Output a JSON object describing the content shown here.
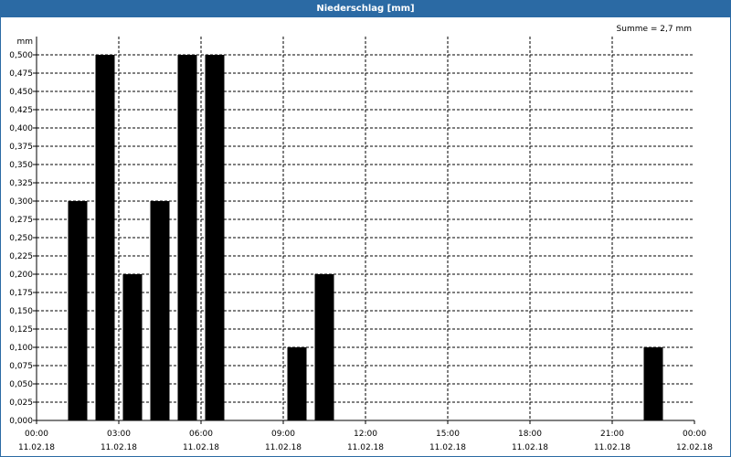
{
  "window": {
    "title": "Niederschlag [mm]"
  },
  "summary": {
    "text": "Summe = 2,7 mm"
  },
  "colors": {
    "titlebar": "#2b6aa4",
    "bar": "#000000",
    "grid": "#000000",
    "background": "#ffffff"
  },
  "chart_data": {
    "type": "bar",
    "title": "Niederschlag [mm]",
    "ylabel": "mm",
    "ylim": [
      0,
      0.5
    ],
    "yticks": [
      "0,000",
      "0,025",
      "0,050",
      "0,075",
      "0,100",
      "0,125",
      "0,150",
      "0,175",
      "0,200",
      "0,225",
      "0,250",
      "0,275",
      "0,300",
      "0,325",
      "0,350",
      "0,375",
      "0,400",
      "0,425",
      "0,450",
      "0,475",
      "0,500"
    ],
    "xlim_hours": [
      0,
      24
    ],
    "xticks": [
      {
        "time": "00:00",
        "date": "11.02.18"
      },
      {
        "time": "03:00",
        "date": "11.02.18"
      },
      {
        "time": "06:00",
        "date": "11.02.18"
      },
      {
        "time": "09:00",
        "date": "11.02.18"
      },
      {
        "time": "12:00",
        "date": "11.02.18"
      },
      {
        "time": "15:00",
        "date": "11.02.18"
      },
      {
        "time": "18:00",
        "date": "11.02.18"
      },
      {
        "time": "21:00",
        "date": "11.02.18"
      },
      {
        "time": "00:00",
        "date": "12.02.18"
      }
    ],
    "bars": [
      {
        "hour": 1.5,
        "value": 0.3
      },
      {
        "hour": 2.5,
        "value": 0.5
      },
      {
        "hour": 3.5,
        "value": 0.2
      },
      {
        "hour": 4.5,
        "value": 0.3
      },
      {
        "hour": 5.5,
        "value": 0.5
      },
      {
        "hour": 6.5,
        "value": 0.5
      },
      {
        "hour": 9.5,
        "value": 0.1
      },
      {
        "hour": 10.5,
        "value": 0.2
      },
      {
        "hour": 22.5,
        "value": 0.1
      }
    ],
    "grid": true
  }
}
